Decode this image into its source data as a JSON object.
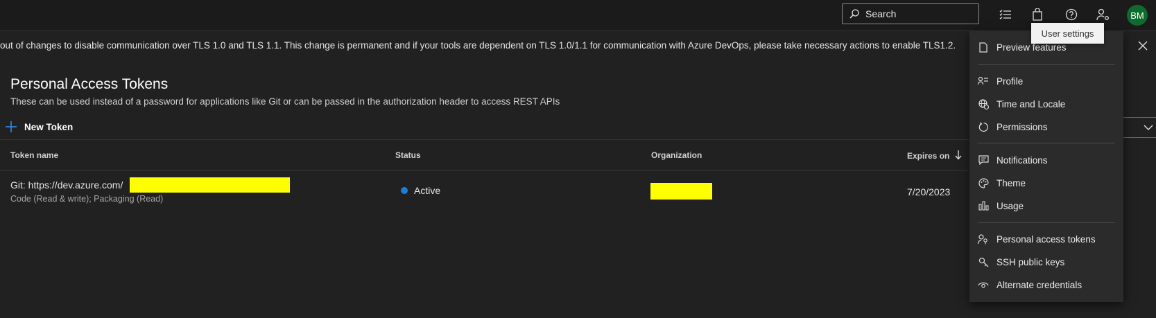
{
  "topbar": {
    "search_placeholder": "Search",
    "avatar_initials": "BM",
    "icons": [
      "task-list-icon",
      "shopping-bag-icon",
      "help-icon",
      "user-settings-icon"
    ]
  },
  "tooltip": {
    "text": "User settings"
  },
  "banner": {
    "text": "out of changes to disable communication over TLS 1.0 and TLS 1.1. This change is permanent and if your tools are dependent on TLS 1.0/1.1 for communication with Azure DevOps, please take necessary actions to enable TLS1.2."
  },
  "page": {
    "title": "Personal Access Tokens",
    "subtitle": "These can be used instead of a password for applications like Git or can be passed in the authorization header to access REST APIs",
    "new_token_label": "New Token"
  },
  "table": {
    "headers": {
      "name": "Token name",
      "status": "Status",
      "organization": "Organization",
      "expires": "Expires on"
    },
    "rows": [
      {
        "name": "Git: https://dev.azure.com/",
        "scopes": "Code (Read & write); Packaging (Read)",
        "status": "Active",
        "expires": "7/20/2023"
      }
    ]
  },
  "menu": {
    "items": [
      {
        "label": "Preview features",
        "icon": "page-icon"
      },
      {
        "label": "Profile",
        "icon": "profile-icon"
      },
      {
        "label": "Time and Locale",
        "icon": "globe-clock-icon"
      },
      {
        "label": "Permissions",
        "icon": "refresh-icon"
      },
      {
        "label": "Notifications",
        "icon": "message-icon"
      },
      {
        "label": "Theme",
        "icon": "palette-icon"
      },
      {
        "label": "Usage",
        "icon": "bar-chart-icon"
      },
      {
        "label": "Personal access tokens",
        "icon": "person-key-icon"
      },
      {
        "label": "SSH public keys",
        "icon": "key-icon"
      },
      {
        "label": "Alternate credentials",
        "icon": "eye-icon"
      }
    ]
  },
  "colors": {
    "accent": "#1a7fd8",
    "avatar": "#0e6b2d",
    "redaction": "#ffff00"
  }
}
